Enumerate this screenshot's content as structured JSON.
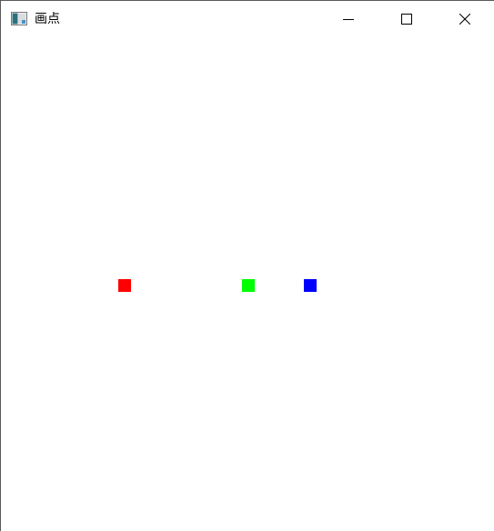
{
  "window": {
    "title": "画点",
    "title_icon": "app-window-icon",
    "controls": [
      {
        "name": "minimize",
        "icon": "minimize-icon"
      },
      {
        "name": "maximize",
        "icon": "maximize-icon"
      },
      {
        "name": "close",
        "icon": "close-icon"
      }
    ]
  },
  "canvas": {
    "background": "#ffffff",
    "points": [
      {
        "name": "red-point",
        "color": "#ff0000"
      },
      {
        "name": "green-point",
        "color": "#00ff00"
      },
      {
        "name": "blue-point",
        "color": "#0000ff"
      }
    ]
  }
}
